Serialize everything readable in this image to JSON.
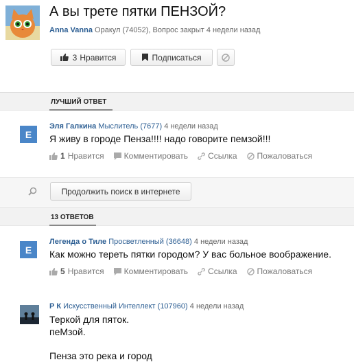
{
  "question": {
    "title": "А вы трете пятки ПЕНЗОЙ?",
    "author": "Anna Vanna",
    "rank": "Оракул (74052),",
    "status": "Вопрос закрыт 4 недели назад"
  },
  "toolbar": {
    "like_count": "3",
    "like_label": "Нравится",
    "subscribe_label": "Подписаться"
  },
  "best_answer": {
    "section_label": "ЛУЧШИЙ ОТВЕТ",
    "avatar_letter": "Е",
    "author": "Эля Галкина",
    "rank": "Мыслитель (7677)",
    "time": "4 недели назад",
    "text": "Я живу в городе Пенза!!!! надо говорите пемзой!!!",
    "like_count": "1",
    "like_label": "Нравится",
    "comment_label": "Комментировать",
    "link_label": "Ссылка",
    "report_label": "Пожаловаться"
  },
  "search": {
    "button_label": "Продолжить поиск в интернете"
  },
  "answers_section": {
    "label": "13 ОТВЕТОВ"
  },
  "answers": [
    {
      "avatar_letter": "Е",
      "author": "Легенда о Тиле",
      "rank": "Просветленный (36648)",
      "time": "4 недели назад",
      "text": "Как можно тереть пятки городом? У вас больное воображение.",
      "like_count": "5",
      "like_label": "Нравится",
      "comment_label": "Комментировать",
      "link_label": "Ссылка",
      "report_label": "Пожаловаться"
    },
    {
      "author": "Р К",
      "rank": "Искусственный Интеллект (107960)",
      "time": "4 недели назад",
      "text_lines": [
        "Теркой для пяток.",
        "пеМзой.",
        "",
        "Пенза это река и город"
      ]
    }
  ],
  "colors": {
    "link_blue": "#2c5e93",
    "avatar_blue": "#4a86c8",
    "section_bg": "#f2f2f2"
  }
}
